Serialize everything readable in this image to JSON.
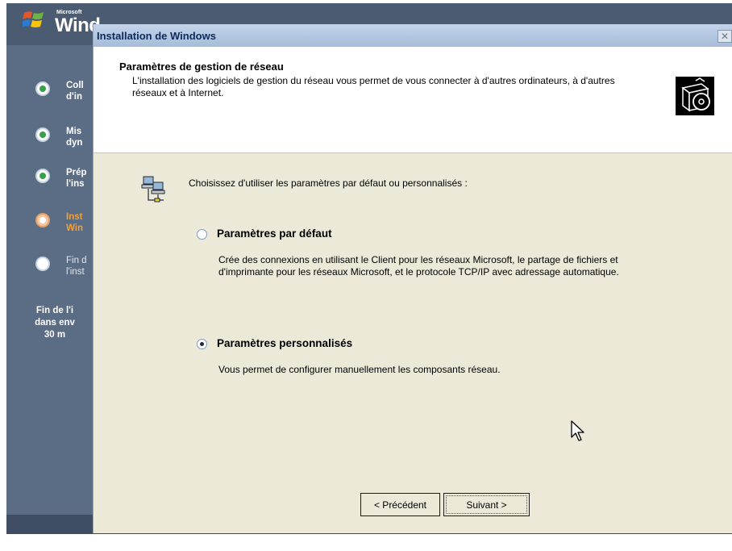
{
  "background": {
    "brand_small": "Microsoft",
    "brand_title": "Wind",
    "steps": [
      {
        "text": "Coll\nd'in",
        "state": "done"
      },
      {
        "text": "Mis\ndyn",
        "state": "done"
      },
      {
        "text": "Prép\nl'ins",
        "state": "done"
      },
      {
        "text": "Inst\nWin",
        "state": "current"
      },
      {
        "text": "Fin d\nl'inst",
        "state": "todo"
      }
    ],
    "time_left": "Fin de l'i\ndans env\n30 m",
    "colors": {
      "panel": "#5a6d85",
      "done": "#36a04a",
      "current": "#f0a13e"
    }
  },
  "dialog": {
    "title": "Installation de Windows",
    "close_label": "✕",
    "header_title": "Paramètres de gestion de réseau",
    "header_subtitle": "L'installation des logiciels de gestion du réseau vous permet de vous connecter à d'autres ordinateurs, à d'autres réseaux et à Internet.",
    "header_icon": "setup-box-cd-icon",
    "network_icon": "network-computers-icon",
    "prompt": "Choisissez d'utiliser les paramètres par défaut ou personnalisés :",
    "options": [
      {
        "label": "Paramètres par défaut",
        "description": "Crée des connexions en utilisant le Client pour les réseaux Microsoft, le partage de fichiers et d'imprimante pour les réseaux Microsoft, et le protocole TCP/IP avec adressage automatique.",
        "selected": false
      },
      {
        "label": "Paramètres personnalisés",
        "description": "Vous permet de configurer manuellement les composants réseau.",
        "selected": true
      }
    ],
    "back_button": "< Précédent",
    "next_button": "Suivant >"
  }
}
